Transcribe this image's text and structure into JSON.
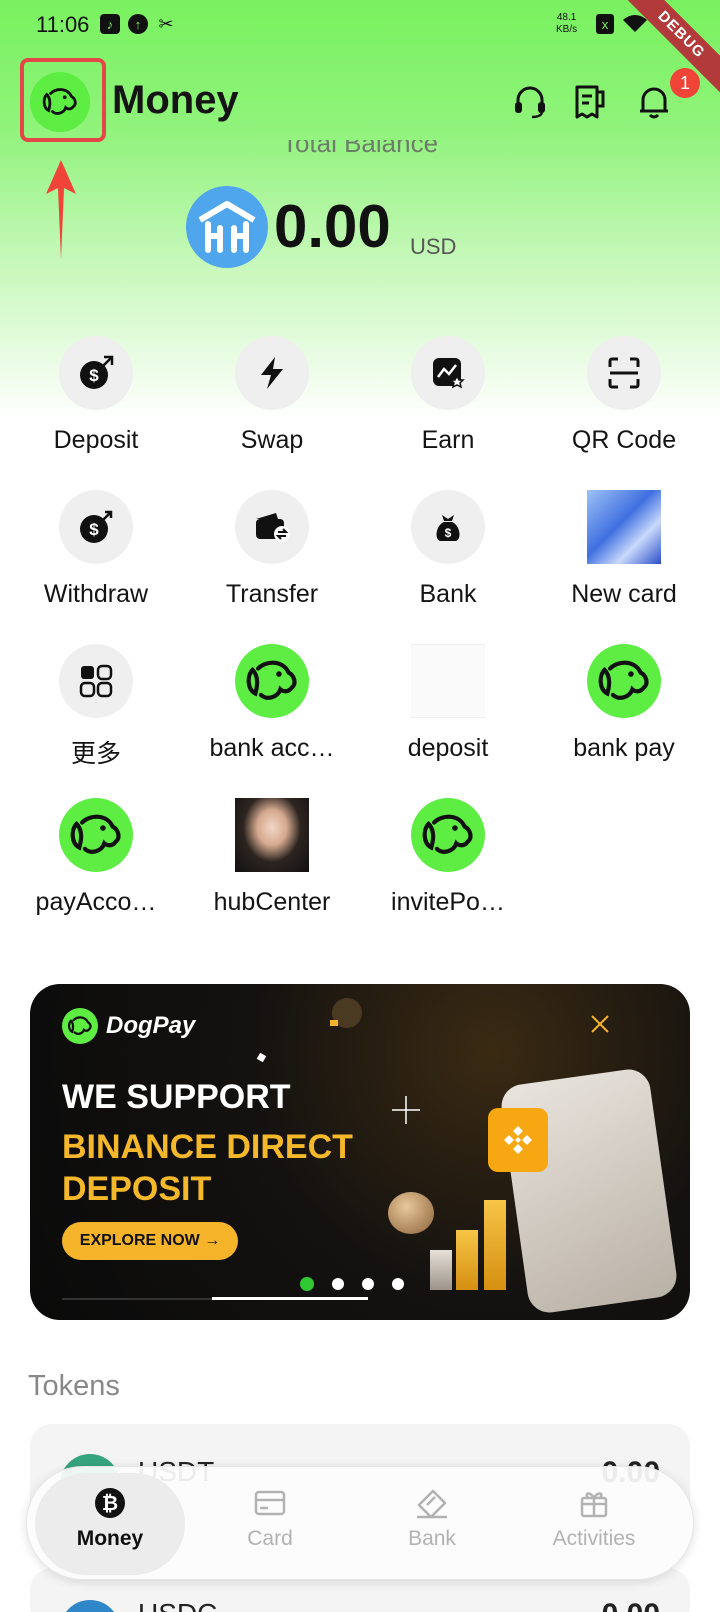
{
  "status_bar": {
    "time": "11:06",
    "net_speed": "48.1",
    "net_unit": "KB/s",
    "debug_label": "DEBUG"
  },
  "header": {
    "title": "Money",
    "notification_count": "1"
  },
  "balance": {
    "label": "Total Balance",
    "value": "0.00",
    "unit": "USD"
  },
  "actions": [
    {
      "label": "Deposit",
      "icon": "deposit-icon"
    },
    {
      "label": "Swap",
      "icon": "lightning-icon"
    },
    {
      "label": "Earn",
      "icon": "earn-icon"
    },
    {
      "label": "QR Code",
      "icon": "qr-scan-icon"
    },
    {
      "label": "Withdraw",
      "icon": "withdraw-icon"
    },
    {
      "label": "Transfer",
      "icon": "transfer-icon"
    },
    {
      "label": "Bank",
      "icon": "bank-bag-icon"
    },
    {
      "label": "New card",
      "icon": "card-image-icon"
    },
    {
      "label": "更多",
      "icon": "more-grid-icon"
    },
    {
      "label": "bank acc…",
      "icon": "dog-logo-icon"
    },
    {
      "label": "deposit",
      "icon": "blank-thumbnail-icon"
    },
    {
      "label": "bank pay",
      "icon": "dog-logo-icon"
    },
    {
      "label": "payAcco…",
      "icon": "dog-logo-icon"
    },
    {
      "label": "hubCenter",
      "icon": "portrait-photo-icon"
    },
    {
      "label": "invitePo…",
      "icon": "dog-logo-icon"
    }
  ],
  "banner": {
    "brand": "DogPay",
    "line1": "WE SUPPORT",
    "line2": "BINANCE DIRECT",
    "line3": "DEPOSIT",
    "cta": "EXPLORE NOW →",
    "active_slide": 1,
    "slide_count": 4
  },
  "tokens": {
    "title": "Tokens",
    "items": [
      {
        "name": "USDT",
        "amount": "0.00"
      },
      {
        "name": "USDC",
        "amount": "0.00"
      }
    ]
  },
  "bottom_nav": [
    {
      "label": "Money",
      "icon": "bitcoin-icon",
      "active": true
    },
    {
      "label": "Card",
      "icon": "card-icon",
      "active": false
    },
    {
      "label": "Bank",
      "icon": "bank-tag-icon",
      "active": false
    },
    {
      "label": "Activities",
      "icon": "gift-icon",
      "active": false
    }
  ],
  "colors": {
    "brand_green": "#5ded43",
    "accent_yellow": "#f6b42a",
    "alert_red": "#f04438",
    "highlight_box": "#e44747"
  }
}
